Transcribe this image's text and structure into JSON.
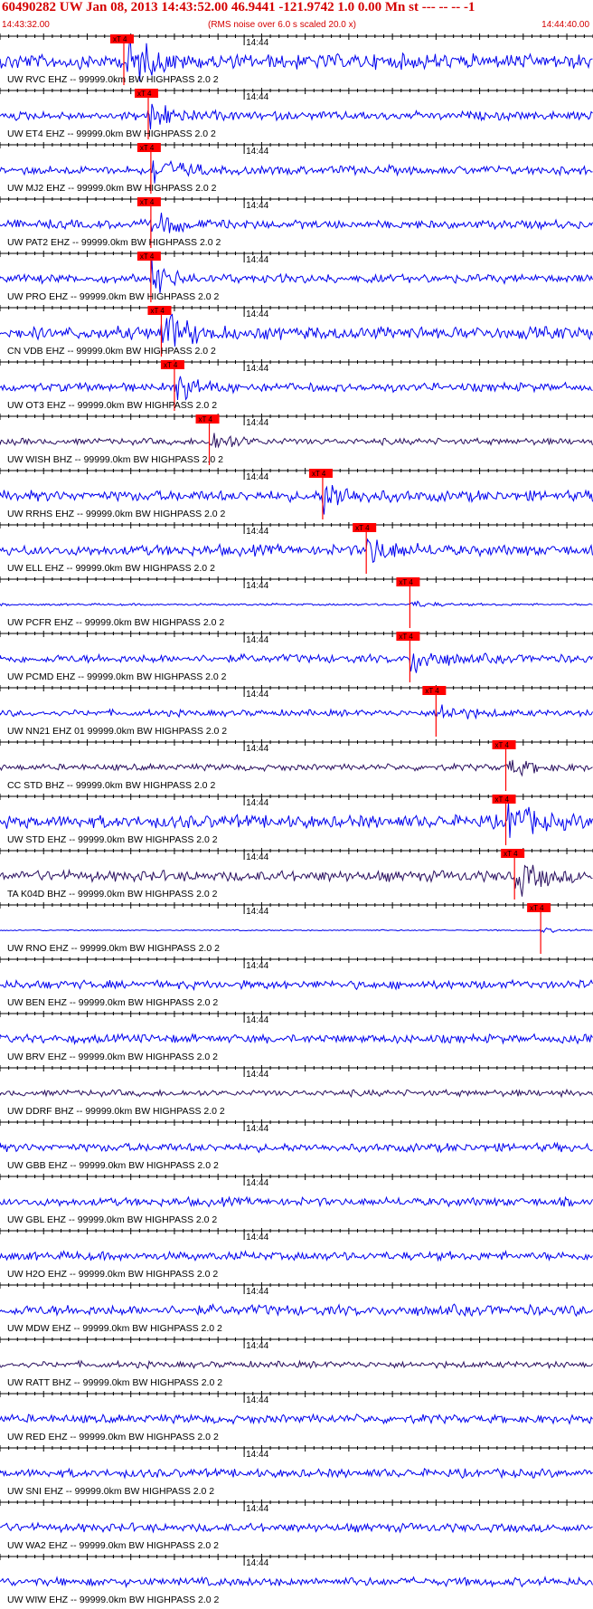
{
  "header": {
    "title": "60490282 UW Jan 08, 2013 14:43:52.00   46.9441 -121.9742  1.0 0.00 Mn st --- -- --   -1",
    "start_time": "14:43:32.00",
    "subtitle": "(RMS noise over 6.0 s scaled 20.0 x)",
    "end_time": "14:44:40.00"
  },
  "colors": {
    "trace_blue": "#0000ee",
    "trace_dark": "#2a1060",
    "marker_red": "#ff0000",
    "axis": "#000000"
  },
  "chart_data": {
    "type": "line",
    "title": "60490282 UW Jan 08, 2013 14:43:52.00   46.9441 -121.9742  1.0 0.00 Mn st --- -- --   -1",
    "x_range_seconds": [
      0,
      68
    ],
    "minute_label": "14:44",
    "minute_mark_seconds": 28,
    "pick_label": "xT 4",
    "traces": [
      {
        "label": "UW RVC EHZ -- 99999.0km BW  HIGHPASS  2.0  2",
        "pick_s": 14.2,
        "color": "blue",
        "amp": 0.35
      },
      {
        "label": "UW ET4 EHZ -- 99999.0km BW  HIGHPASS  2.0  2",
        "pick_s": 17.0,
        "color": "blue",
        "amp": 0.2
      },
      {
        "label": "UW MJ2 EHZ -- 99999.0km BW  HIGHPASS  2.0  2",
        "pick_s": 17.3,
        "color": "blue",
        "amp": 0.2
      },
      {
        "label": "UW PAT2 EHZ -- 99999.0km BW  HIGHPASS  2.0  2",
        "pick_s": 17.3,
        "color": "blue",
        "amp": 0.2
      },
      {
        "label": "UW PRO EHZ -- 99999.0km BW  HIGHPASS  2.0  2",
        "pick_s": 17.3,
        "color": "blue",
        "amp": 0.2
      },
      {
        "label": "CN VDB EHZ -- 99999.0km BW  HIGHPASS  2.0  2",
        "pick_s": 18.5,
        "color": "blue",
        "amp": 0.3
      },
      {
        "label": "UW OT3 EHZ -- 99999.0km BW  HIGHPASS  2.0  2",
        "pick_s": 20.0,
        "color": "blue",
        "amp": 0.2
      },
      {
        "label": "UW WISH BHZ -- 99999.0km BW  HIGHPASS  2.0  2",
        "pick_s": 24.0,
        "color": "dark",
        "amp": 0.15
      },
      {
        "label": "UW RRHS EHZ -- 99999.0km BW  HIGHPASS  2.0  2",
        "pick_s": 37.0,
        "color": "blue",
        "amp": 0.25
      },
      {
        "label": "UW ELL EHZ -- 99999.0km BW  HIGHPASS  2.0  2",
        "pick_s": 42.0,
        "color": "blue",
        "amp": 0.25
      },
      {
        "label": "UW PCFR EHZ -- 99999.0km BW  HIGHPASS  2.0  2",
        "pick_s": 47.0,
        "color": "blue",
        "amp": 0.05
      },
      {
        "label": "UW PCMD EHZ -- 99999.0km BW  HIGHPASS  2.0  2",
        "pick_s": 47.0,
        "color": "blue",
        "amp": 0.2
      },
      {
        "label": "UW NN21 EHZ 01 99999.0km BW  HIGHPASS  2.0  2",
        "pick_s": 50.0,
        "color": "blue",
        "amp": 0.15
      },
      {
        "label": "CC STD BHZ -- 99999.0km BW  HIGHPASS  2.0  2",
        "pick_s": 58.0,
        "color": "dark",
        "amp": 0.15
      },
      {
        "label": "UW STD EHZ -- 99999.0km BW  HIGHPASS  2.0  2",
        "pick_s": 58.0,
        "color": "blue",
        "amp": 0.3
      },
      {
        "label": "TA K04D BHZ -- 99999.0km BW  HIGHPASS  2.0  2",
        "pick_s": 59.0,
        "color": "dark",
        "amp": 0.25
      },
      {
        "label": "UW RNO EHZ -- 99999.0km BW  HIGHPASS  2.0  2",
        "pick_s": 62.0,
        "color": "blue",
        "amp": 0.03
      },
      {
        "label": "UW BEN EHZ -- 99999.0km BW  HIGHPASS  2.0  2",
        "pick_s": null,
        "color": "blue",
        "amp": 0.2
      },
      {
        "label": "UW BRV EHZ -- 99999.0km BW  HIGHPASS  2.0  2",
        "pick_s": null,
        "color": "blue",
        "amp": 0.2
      },
      {
        "label": "UW DDRF BHZ -- 99999.0km BW  HIGHPASS  2.0  2",
        "pick_s": null,
        "color": "dark",
        "amp": 0.15
      },
      {
        "label": "UW GBB EHZ -- 99999.0km BW  HIGHPASS  2.0  2",
        "pick_s": null,
        "color": "blue",
        "amp": 0.2
      },
      {
        "label": "UW GBL EHZ -- 99999.0km BW  HIGHPASS  2.0  2",
        "pick_s": null,
        "color": "blue",
        "amp": 0.2
      },
      {
        "label": "UW H2O EHZ -- 99999.0km BW  HIGHPASS  2.0  2",
        "pick_s": null,
        "color": "blue",
        "amp": 0.2
      },
      {
        "label": "UW MDW EHZ -- 99999.0km BW  HIGHPASS  2.0  2",
        "pick_s": null,
        "color": "blue",
        "amp": 0.25
      },
      {
        "label": "UW RATT BHZ -- 99999.0km BW  HIGHPASS  2.0  2",
        "pick_s": null,
        "color": "dark",
        "amp": 0.15
      },
      {
        "label": "UW RED EHZ -- 99999.0km BW  HIGHPASS  2.0  2",
        "pick_s": null,
        "color": "blue",
        "amp": 0.2
      },
      {
        "label": "UW SNI EHZ -- 99999.0km BW  HIGHPASS  2.0  2",
        "pick_s": null,
        "color": "blue",
        "amp": 0.2
      },
      {
        "label": "UW WA2 EHZ -- 99999.0km BW  HIGHPASS  2.0  2",
        "pick_s": null,
        "color": "blue",
        "amp": 0.2
      },
      {
        "label": "UW WIW EHZ -- 99999.0km BW  HIGHPASS  2.0  2",
        "pick_s": null,
        "color": "blue",
        "amp": 0.2
      }
    ]
  }
}
